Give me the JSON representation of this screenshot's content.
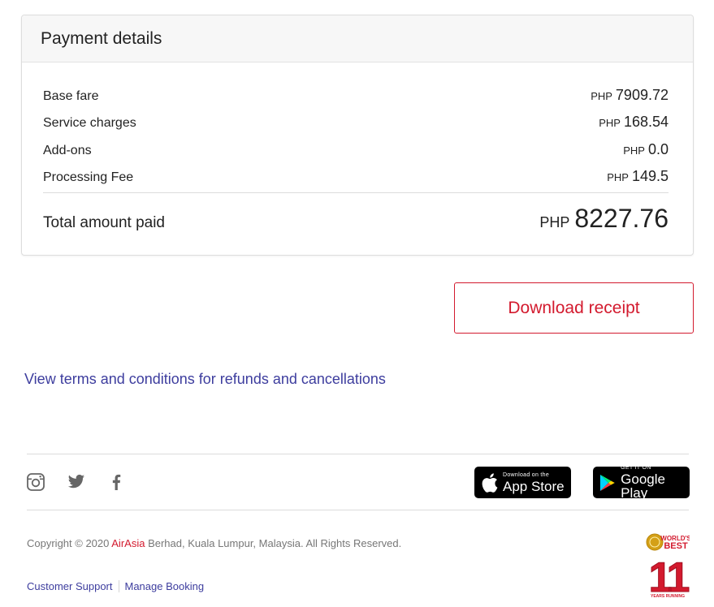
{
  "payment": {
    "title": "Payment details",
    "rows": [
      {
        "label": "Base fare",
        "currency": "PHP",
        "amount": "7909.72"
      },
      {
        "label": "Service charges",
        "currency": "PHP",
        "amount": "168.54"
      },
      {
        "label": "Add-ons",
        "currency": "PHP",
        "amount": "0.0"
      },
      {
        "label": "Processing Fee",
        "currency": "PHP",
        "amount": "149.5"
      }
    ],
    "total": {
      "label": "Total amount paid",
      "currency": "PHP",
      "amount": "8227.76"
    }
  },
  "actions": {
    "download_label": "Download receipt"
  },
  "links": {
    "terms_label": "View terms and conditions for refunds and cancellations"
  },
  "footer": {
    "social_icons": [
      "instagram-icon",
      "twitter-icon",
      "facebook-icon"
    ],
    "app_store": {
      "small": "Download on the",
      "big": "App Store"
    },
    "google_play": {
      "small": "GET IT ON",
      "big": "Google Play"
    },
    "copyright_prefix": "Copyright © 2020 ",
    "brand": "AirAsia",
    "copyright_suffix": " Berhad, Kuala Lumpur, Malaysia. All Rights Reserved.",
    "customer_support": "Customer Support",
    "manage_booking": "Manage Booking",
    "award": {
      "top": "WORLD'S",
      "middle": "BEST",
      "number": "11",
      "bottom": "YEARS RUNNING"
    }
  },
  "colors": {
    "accent_red": "#d31a2e",
    "link_blue": "#3d3d9e"
  }
}
